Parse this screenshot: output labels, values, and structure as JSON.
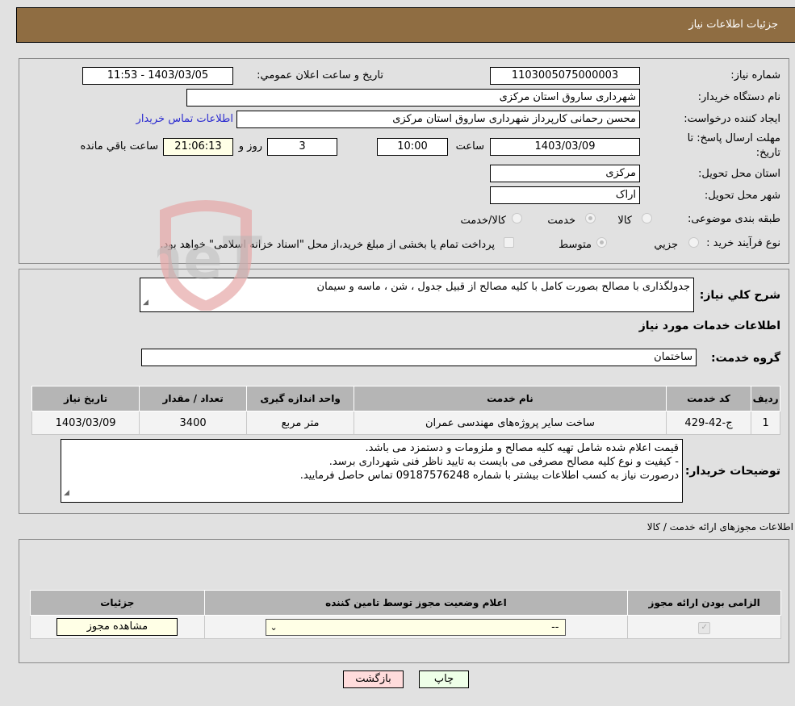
{
  "header": {
    "title": "جزئیات اطلاعات نیاز"
  },
  "info": {
    "need_number_label": "شماره نیاز:",
    "need_number": "1103005075000003",
    "announce_label": "تاریخ و ساعت اعلان عمومي:",
    "announce_value": "1403/03/05 - 11:53",
    "buyer_org_label": "نام دستگاه خريدار:",
    "buyer_org": "شهرداری ساروق استان مرکزی",
    "creator_label": "ايجاد کننده درخواست:",
    "creator": "محسن  رحمانی کارپرداز شهرداری ساروق استان مرکزی",
    "contact_link": "اطلاعات تماس خریدار",
    "deadline_label_1": "مهلت ارسال پاسخ: تا",
    "deadline_label_2": "تاريخ:",
    "deadline_date": "1403/03/09",
    "time_label": "ساعت",
    "deadline_time": "10:00",
    "days_value": "3",
    "days_label": "روز و",
    "remaining_time": "21:06:13",
    "remaining_label": "ساعت باقي مانده",
    "province_label": "استان محل تحويل:",
    "province": "مرکزی",
    "city_label": "شهر محل تحويل:",
    "city": "اراک",
    "category_label": "طبقه بندی موضوعی:",
    "category_options": [
      {
        "label": "کالا",
        "checked": false
      },
      {
        "label": "خدمت",
        "checked": true
      },
      {
        "label": "کالا/خدمت",
        "checked": false
      }
    ],
    "process_label": "نوع فرآيند خريد :",
    "process_options": [
      {
        "label": "جزيي",
        "checked": false
      },
      {
        "label": "متوسط",
        "checked": true
      }
    ],
    "treasury_note": "پرداخت تمام يا بخشی از مبلغ خريد،از محل \"اسناد خزانه اسلامی\" خواهد بود."
  },
  "description": {
    "label": "شرح کلي نياز:",
    "value": "جدولگذاری با مصالح بصورت کامل با کلیه مصالح از قبیل جدول ، شن ، ماسه و سیمان"
  },
  "services": {
    "section_title": "اطلاعات خدمات مورد نياز",
    "group_label": "گروه خدمت:",
    "group_value": "ساختمان",
    "columns": [
      "رديف",
      "کد خدمت",
      "نام خدمت",
      "واحد اندازه گيری",
      "تعداد / مقدار",
      "تاريخ نياز"
    ],
    "rows": [
      [
        "1",
        "ج-42-429",
        "ساخت سایر پروژه‌های مهندسی عمران",
        "متر مربع",
        "3400",
        "1403/03/09"
      ]
    ]
  },
  "buyer_notes": {
    "label": "توضيحات خريدار:",
    "lines": [
      "قیمت اعلام شده شامل تهیه کلیه مصالح و ملزومات و دستمزد می باشد.",
      "- کیفیت و نوع کلیه مصالح مصرفی می بایست به تایید ناظر فنی شهرداری برسد.",
      " درصورت نیاز به کسب اطلاعات بیشتر با شماره 09187576248 تماس حاصل فرمایید."
    ]
  },
  "permits": {
    "section_title": "اطلاعات مجوزهای ارائه خدمت / کالا",
    "columns": [
      "الزامی بودن ارائه مجوز",
      "اعلام وضعیت مجوز توسط تامین کننده",
      "جزئیات"
    ],
    "row": {
      "required_checked": true,
      "status_value": "--",
      "details_button": "مشاهده مجوز"
    }
  },
  "footer": {
    "print_button": "چاپ",
    "back_button": "بازگشت"
  },
  "watermark": {
    "text": "AriaTender.neT"
  }
}
